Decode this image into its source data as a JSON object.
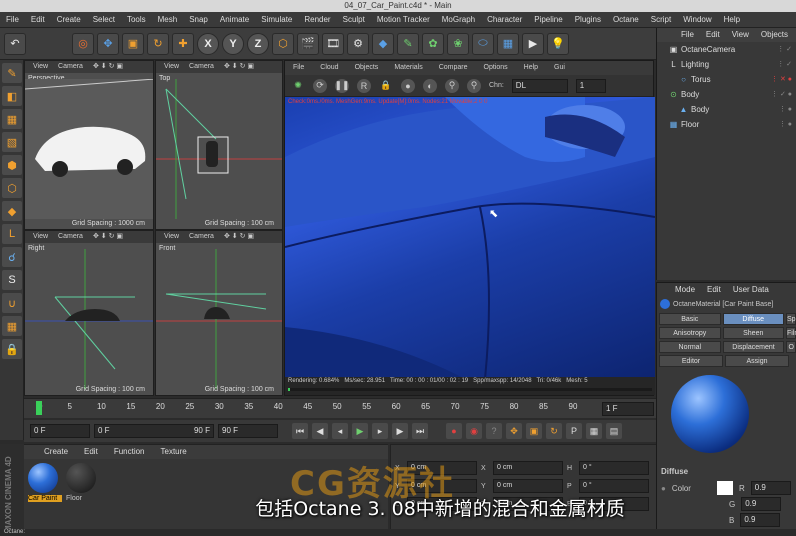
{
  "window": {
    "title": "04_07_Car_Paint.c4d * - Main"
  },
  "menu": [
    "File",
    "Edit",
    "Create",
    "Select",
    "Tools",
    "Mesh",
    "Snap",
    "Animate",
    "Simulate",
    "Render",
    "Sculpt",
    "Motion Tracker",
    "MoGraph",
    "Character",
    "Pipeline",
    "Plugins",
    "Octane",
    "Script",
    "Window",
    "Help"
  ],
  "axes": {
    "x": "X",
    "y": "Y",
    "z": "Z"
  },
  "viewports": {
    "menu": [
      "View",
      "Camera"
    ],
    "perspective": {
      "name": "Perspective",
      "grid": "Grid Spacing : 1000 cm"
    },
    "top": {
      "name": "Top",
      "grid": "Grid Spacing : 100 cm"
    },
    "right": {
      "name": "Right",
      "grid": "Grid Spacing : 100 cm"
    },
    "front": {
      "name": "Front",
      "grid": "Grid Spacing : 100 cm"
    }
  },
  "octane": {
    "menu": [
      "File",
      "Cloud",
      "Objects",
      "Materials",
      "Compare",
      "Options",
      "Help",
      "Gui"
    ],
    "chn_label": "Chn:",
    "chn_value": "DL",
    "chn_num": "1",
    "check_line": "Check:0ms./0ms. MeshGen:9ms. Update[M]:0ms. Nodes:21 Movable:2 0 0",
    "status": {
      "rendering": "Rendering: 0.684%",
      "mssec": "Ms/sec: 28.951",
      "time": "Time: 00 : 00 : 01/00 : 02 : 19",
      "spp": "Spp/maxspp: 14/2048",
      "tri": "Tri: 0/46k",
      "mesh": "Mesh: 5"
    },
    "render_progress": 0.684
  },
  "objects": {
    "menu": [
      "File",
      "Edit",
      "View",
      "Objects"
    ],
    "items": [
      {
        "name": "OctaneCamera",
        "icon": "camera-icon"
      },
      {
        "name": "Lighting",
        "icon": "layer-icon"
      },
      {
        "name": "Torus",
        "icon": "torus-icon"
      },
      {
        "name": "Body",
        "icon": "null-icon"
      },
      {
        "name": "Body",
        "icon": "mesh-icon"
      },
      {
        "name": "Floor",
        "icon": "floor-icon"
      }
    ]
  },
  "attributes": {
    "menu": [
      "Mode",
      "Edit",
      "User Data"
    ],
    "header": "OctaneMaterial [Car Paint Base]",
    "tabs": [
      [
        "Basic",
        "Diffuse",
        "Sp"
      ],
      [
        "Anisotropy",
        "Sheen",
        "Film"
      ],
      [
        "Normal",
        "Displacement",
        "O"
      ],
      [
        "Editor",
        "Assign",
        ""
      ]
    ],
    "section": "Diffuse",
    "color_label": "Color",
    "channels": [
      {
        "k": "R",
        "v": "0.9"
      },
      {
        "k": "G",
        "v": "0.9"
      },
      {
        "k": "B",
        "v": "0.9"
      }
    ]
  },
  "timeline": {
    "ticks": [
      "0",
      "5",
      "10",
      "15",
      "20",
      "25",
      "30",
      "35",
      "40",
      "45",
      "50",
      "55",
      "60",
      "65",
      "70",
      "75",
      "80",
      "85",
      "90"
    ],
    "frame": "1 F"
  },
  "transport": {
    "start": "0 F",
    "cur": "0 F",
    "end_small": "90 F",
    "end": "90 F"
  },
  "materials": {
    "menu": [
      "Create",
      "Edit",
      "Function",
      "Texture"
    ],
    "items": [
      {
        "name": "Car Paint"
      },
      {
        "name": "Floor"
      }
    ]
  },
  "coords": {
    "rows": [
      [
        "X",
        "0 cm",
        "X",
        "0 cm",
        "H",
        "0 °"
      ],
      [
        "Y",
        "0 cm",
        "Y",
        "0 cm",
        "P",
        "0 °"
      ],
      [
        "Z",
        "0 cm",
        "Z",
        "0 cm",
        "B",
        "0 °"
      ]
    ]
  },
  "brand": "MAXON CINEMA 4D",
  "subtitle": "包括Octane 3. 08中新增的混合和金属材质",
  "watermark": "CG资源社",
  "bottom_status": "Octane:"
}
